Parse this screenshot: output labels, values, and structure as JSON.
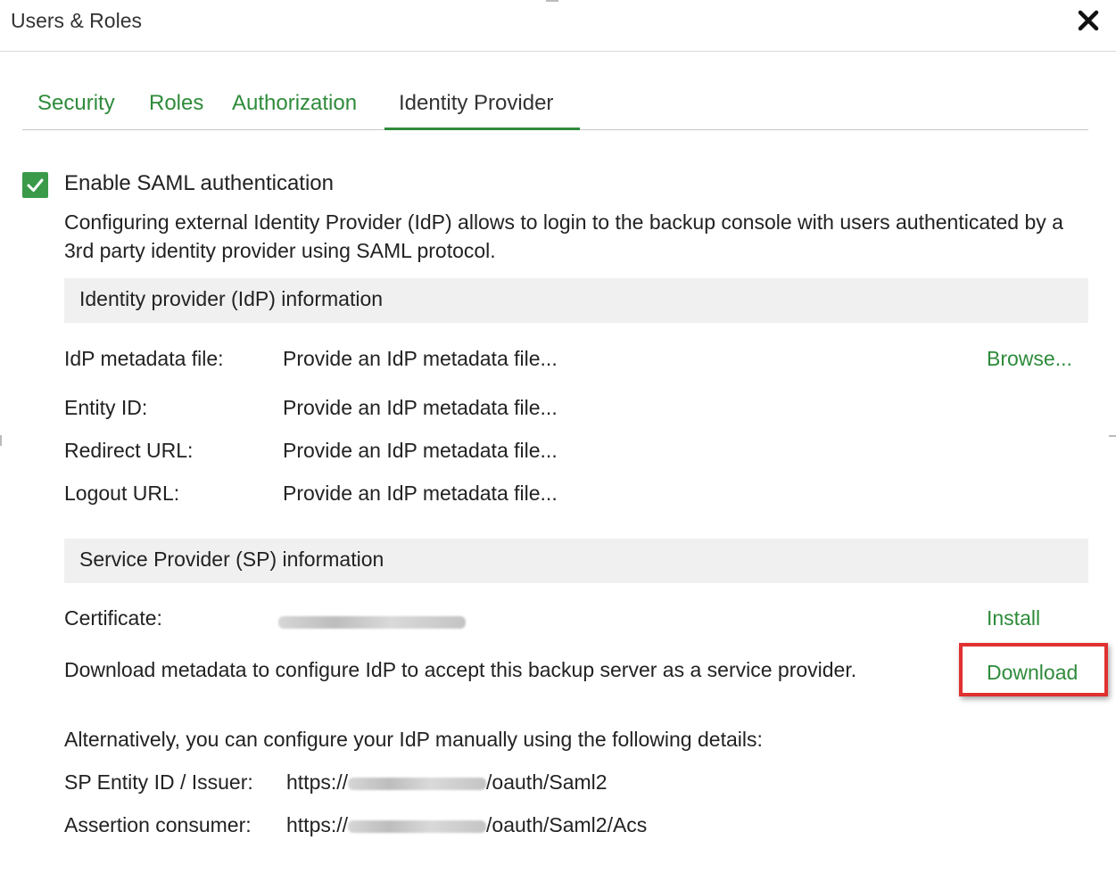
{
  "window": {
    "title": "Users & Roles"
  },
  "tabs": [
    {
      "label": "Security"
    },
    {
      "label": "Roles"
    },
    {
      "label": "Authorization"
    },
    {
      "label": "Identity Provider",
      "active": true
    }
  ],
  "saml": {
    "enable_label": "Enable SAML authentication",
    "enabled": true,
    "description": "Configuring external Identity Provider (IdP) allows to login to the backup console with users authenticated by a 3rd party identity provider using SAML protocol."
  },
  "idp_section": {
    "header": "Identity provider (IdP) information",
    "metadata_file_label": "IdP metadata file:",
    "metadata_file_value": "Provide an IdP metadata file...",
    "browse_label": "Browse...",
    "entity_id_label": "Entity ID:",
    "entity_id_value": "Provide an IdP metadata file...",
    "redirect_url_label": "Redirect URL:",
    "redirect_url_value": "Provide an IdP metadata file...",
    "logout_url_label": "Logout URL:",
    "logout_url_value": "Provide an IdP metadata file..."
  },
  "sp_section": {
    "header": "Service Provider (SP) information",
    "certificate_label": "Certificate:",
    "install_label": "Install",
    "download_text": "Download metadata to configure IdP to accept this backup server as a service provider.",
    "download_label": "Download",
    "alternative_text": "Alternatively, you can configure your IdP manually using the following details:",
    "entity_issuer_label": "SP Entity ID / Issuer:",
    "entity_issuer_prefix": "https://",
    "entity_issuer_suffix": "/oauth/Saml2",
    "assertion_label": "Assertion consumer:",
    "assertion_prefix": "https://",
    "assertion_suffix": "/oauth/Saml2/Acs"
  },
  "colors": {
    "accent": "#2e8b3a",
    "highlight": "#e03030",
    "section_bg": "#f0f0f0"
  }
}
